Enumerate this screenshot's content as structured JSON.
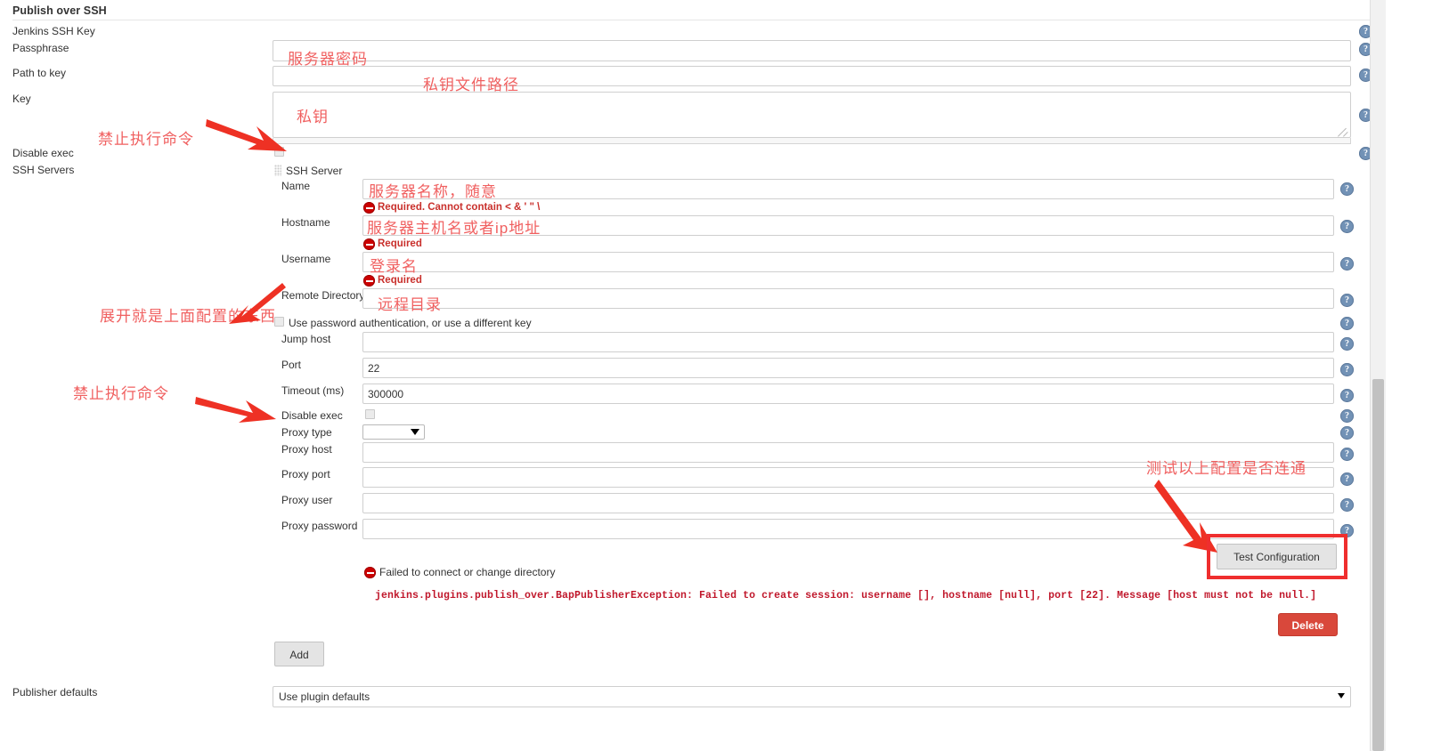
{
  "section": {
    "title": "Publish over SSH"
  },
  "global": {
    "jenkins_ssh_key_label": "Jenkins SSH Key",
    "passphrase_label": "Passphrase",
    "passphrase_value": "",
    "path_to_key_label": "Path to key",
    "path_to_key_value": "",
    "key_label": "Key",
    "key_value": "",
    "disable_exec_label": "Disable exec",
    "disable_exec_checked": false,
    "ssh_servers_label": "SSH Servers"
  },
  "server_block": {
    "header": "SSH Server",
    "fields": [
      {
        "label": "Name",
        "value": "",
        "type": "text"
      },
      {
        "label": "Hostname",
        "value": "",
        "type": "text"
      },
      {
        "label": "Username",
        "value": "",
        "type": "text"
      },
      {
        "label": "Remote Directory",
        "value": "",
        "type": "text"
      },
      {
        "label": "Jump host",
        "value": "",
        "type": "text"
      },
      {
        "label": "Port",
        "value": "22",
        "type": "text"
      },
      {
        "label": "Timeout (ms)",
        "value": "300000",
        "type": "text"
      },
      {
        "label": "Disable exec",
        "value": "",
        "type": "checkbox"
      },
      {
        "label": "Proxy type",
        "value": "",
        "type": "select"
      },
      {
        "label": "Proxy host",
        "value": "",
        "type": "text"
      },
      {
        "label": "Proxy port",
        "value": "",
        "type": "text"
      },
      {
        "label": "Proxy user",
        "value": "",
        "type": "text"
      },
      {
        "label": "Proxy password",
        "value": "",
        "type": "text"
      }
    ],
    "validation": {
      "name_error": "Required. Cannot contain < & ' \" \\",
      "hostname_error": "Required",
      "username_error": "Required"
    },
    "use_password_auth_label": "Use password authentication, or use a different key",
    "use_password_auth_checked": false,
    "proxy_type_selected": "",
    "proxy_type_options": [
      ""
    ]
  },
  "test": {
    "button_label": "Test Configuration",
    "result_error": "Failed to connect or change directory",
    "exception": "jenkins.plugins.publish_over.BapPublisherException: Failed to create session: username [], hostname [null], port [22]. Message [host must not be null.]"
  },
  "actions": {
    "delete_label": "Delete",
    "add_label": "Add"
  },
  "publisher_defaults": {
    "label": "Publisher defaults",
    "selected": "Use plugin defaults",
    "options": [
      "Use plugin defaults"
    ]
  },
  "annotations": [
    {
      "text": "服务器密码",
      "name": "annotation-passphrase"
    },
    {
      "text": "私钥文件路径",
      "name": "annotation-path-to-key"
    },
    {
      "text": "私钥",
      "name": "annotation-key"
    },
    {
      "text": "禁止执行命令",
      "name": "annotation-disable-exec-top"
    },
    {
      "text": "服务器名称，随意",
      "name": "annotation-server-name"
    },
    {
      "text": "服务器主机名或者ip地址",
      "name": "annotation-hostname"
    },
    {
      "text": "登录名",
      "name": "annotation-username"
    },
    {
      "text": "远程目录",
      "name": "annotation-remote-directory"
    },
    {
      "text": "展开就是上面配置的东西",
      "name": "annotation-expand-hint"
    },
    {
      "text": "禁止执行命令",
      "name": "annotation-disable-exec-server"
    },
    {
      "text": "测试以上配置是否连通",
      "name": "annotation-test-config"
    }
  ],
  "icons": {
    "help": "?"
  }
}
